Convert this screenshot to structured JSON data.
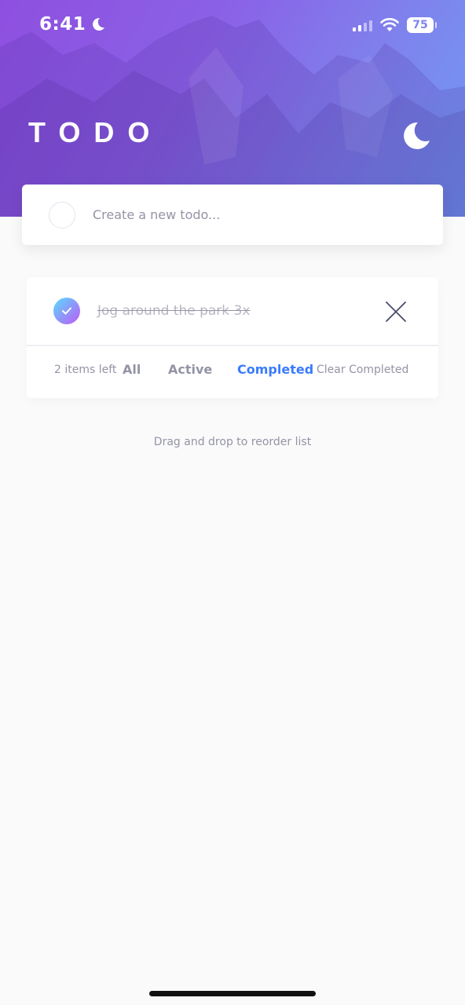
{
  "status_bar": {
    "time": "6:41",
    "battery": "75"
  },
  "header": {
    "title": "TODO",
    "theme_icon": "moon-icon"
  },
  "new_todo": {
    "placeholder": "Create a new todo..."
  },
  "todos": [
    {
      "text": "Jog around the park 3x",
      "completed": true
    }
  ],
  "footer": {
    "items_left": "2 items left",
    "filter_all": "All",
    "filter_active": "Active",
    "filter_completed": "Completed",
    "active_filter": "Completed",
    "clear_completed": "Clear Completed"
  },
  "hint": "Drag and drop to reorder list",
  "colors": {
    "accent": "#3a7bfd",
    "check_gradient_start": "#57ddff",
    "check_gradient_end": "#c058f3",
    "muted_text": "#9394a5"
  }
}
